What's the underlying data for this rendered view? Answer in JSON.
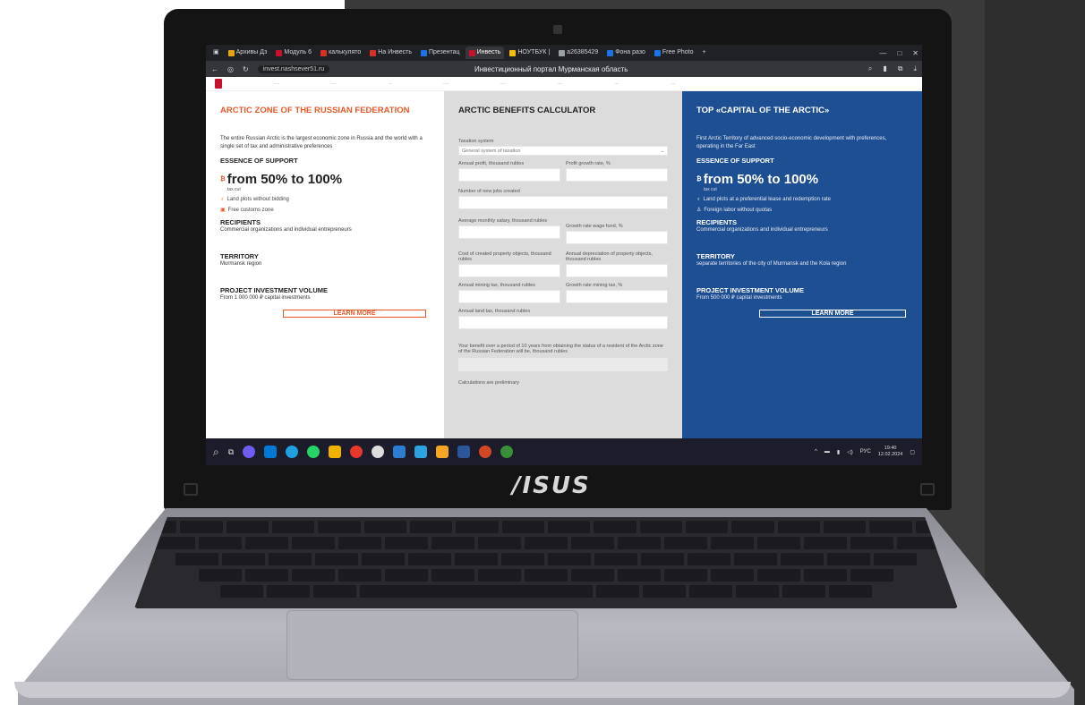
{
  "browser": {
    "tabs": [
      {
        "label": "Архивы Дз",
        "color": "#e5a50a",
        "active": false
      },
      {
        "label": "Модуль 6",
        "color": "#c8102e",
        "active": false
      },
      {
        "label": "калькулято",
        "color": "#d93025",
        "active": false
      },
      {
        "label": "На Инвесть",
        "color": "#d93025",
        "active": false
      },
      {
        "label": "Презентац",
        "color": "#1a73e8",
        "active": false
      },
      {
        "label": "Инвесть",
        "color": "#c8102e",
        "active": true
      },
      {
        "label": "НОУТБУК |",
        "color": "#fbbc04",
        "active": false
      },
      {
        "label": "a26385429",
        "color": "#9aa0a6",
        "active": false
      },
      {
        "label": "Фона разо",
        "color": "#1a73e8",
        "active": false
      },
      {
        "label": "Free Photo",
        "color": "#1a73e8",
        "active": false
      }
    ],
    "url": "invest.nashsever51.ru",
    "page_title": "Инвестиционный портал Мурманская область"
  },
  "col1": {
    "title": "ARCTIC ZONE OF THE RUSSIAN FEDERATION",
    "intro": "The entire Russian Arctic is the largest economic zone in Russia and the world with a single set of tax and administrative preferences",
    "support_title": "ESSENCE OF SUPPORT",
    "tax_value": "from 50% to 100%",
    "tax_label": "tax cut",
    "items": [
      "Land plots without bidding",
      "Free customs zone"
    ],
    "recipients_title": "RECIPIENTS",
    "recipients": "Commercial organizations and individual entrepreneurs",
    "territory_title": "TERRITORY",
    "territory": "Murmansk region",
    "volume_title": "PROJECT INVESTMENT VOLUME",
    "volume": "From 1 000 000 ₽ capital investments",
    "button": "LEARN MORE"
  },
  "col2": {
    "title": "ARCTIC BENEFITS CALCULATOR",
    "tax_system_label": "Taxation system",
    "tax_system_value": "General system of taxation",
    "profit_label": "Annual profit, thousand rubles",
    "profit_growth_label": "Profit growth rate, %",
    "jobs_label": "Number of new jobs created",
    "salary_label": "Average monthly salary, thousand rubles",
    "wage_growth_label": "Growth rate wage fund, %",
    "property_cost_label": "Cost of created property objects, thousand rubles",
    "depreciation_label": "Annual depreciation of property objects, thousand rubles",
    "mining_tax_label": "Annual mining tax, thousand rubles",
    "mining_growth_label": "Growth rate mining tax, %",
    "land_tax_label": "Annual land tax, thousand rubles",
    "result_label": "Your benefit over a period of 10 years from obtaining the status of a resident of the Arctic zone of the Russian Federation will be, thousand rubles",
    "note": "Calculations are preliminary"
  },
  "col3": {
    "title": "TOP «CAPITAL OF THE ARCTIC»",
    "intro": "First Arctic Territory of advanced socio-economic development with preferences, operating in the Far East",
    "support_title": "ESSENCE OF SUPPORT",
    "tax_value": "from 50% to 100%",
    "tax_label": "tax cut",
    "items": [
      "Land plots at a preferential lease and redemption rate",
      "Foreign labor without quotas"
    ],
    "recipients_title": "RECIPIENTS",
    "recipients": "Commercial organizations and individual entrepreneurs",
    "territory_title": "TERRITORY",
    "territory": "separate territories of the city of Murmansk and the Kola region",
    "volume_title": "PROJECT INVESTMENT VOLUME",
    "volume": "From 500 000 ₽ capital investments",
    "button": "LEARN MORE"
  },
  "taskbar": {
    "lang": "РУС",
    "time": "19:40",
    "date": "12.02.2024"
  },
  "laptop": {
    "brand": "/ISUS"
  }
}
